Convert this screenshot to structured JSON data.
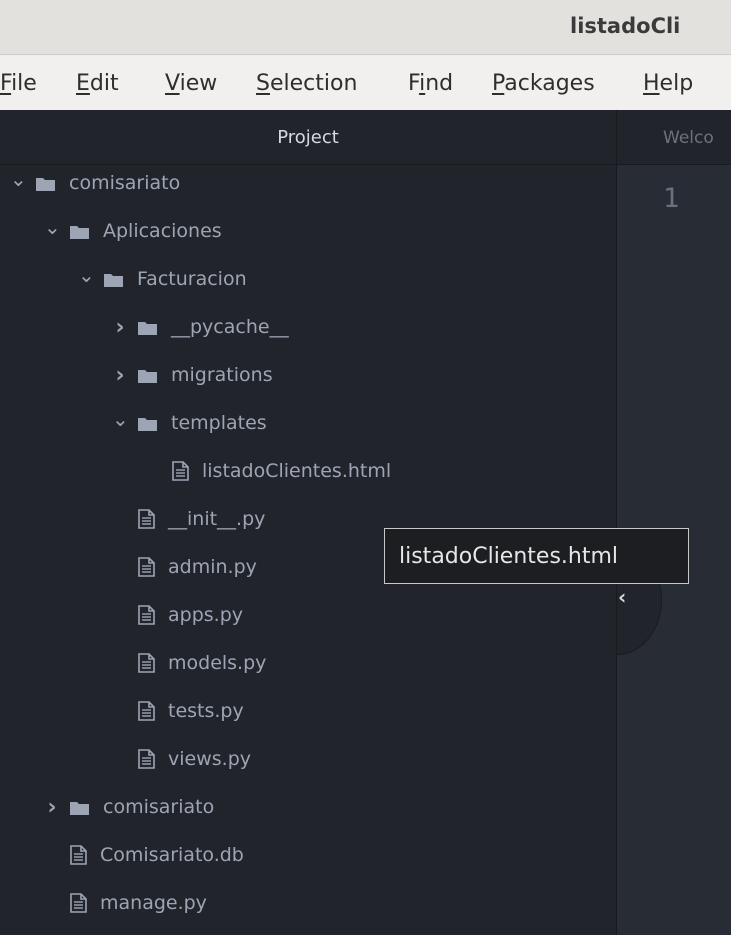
{
  "window": {
    "title": "listadoCli"
  },
  "menu": [
    {
      "accel": "F",
      "rest": "ile"
    },
    {
      "accel": "E",
      "rest": "dit"
    },
    {
      "accel": "V",
      "rest": "iew"
    },
    {
      "accel": "S",
      "rest": "election"
    },
    {
      "pre": "F",
      "accel": "i",
      "rest": "nd"
    },
    {
      "accel": "P",
      "rest": "ackages"
    },
    {
      "accel": "H",
      "rest": "elp"
    }
  ],
  "tree": {
    "header": "Project",
    "items": [
      {
        "label": "comisariato",
        "kind": "folder",
        "chevron": "down"
      },
      {
        "label": "Aplicaciones",
        "kind": "folder",
        "chevron": "down"
      },
      {
        "label": "Facturacion",
        "kind": "folder",
        "chevron": "down"
      },
      {
        "label": "__pycache__",
        "kind": "folder",
        "chevron": "right"
      },
      {
        "label": "migrations",
        "kind": "folder",
        "chevron": "right"
      },
      {
        "label": "templates",
        "kind": "folder",
        "chevron": "down"
      },
      {
        "label": "listadoClientes.html",
        "kind": "file"
      },
      {
        "label": "__init__.py",
        "kind": "file"
      },
      {
        "label": "admin.py",
        "kind": "file"
      },
      {
        "label": "apps.py",
        "kind": "file"
      },
      {
        "label": "models.py",
        "kind": "file"
      },
      {
        "label": "tests.py",
        "kind": "file"
      },
      {
        "label": "views.py",
        "kind": "file"
      },
      {
        "label": "comisariato",
        "kind": "folder",
        "chevron": "right"
      },
      {
        "label": "Comisariato.db",
        "kind": "file"
      },
      {
        "label": "manage.py",
        "kind": "file"
      }
    ]
  },
  "editor": {
    "tab_label": "Welco",
    "line_number": "1"
  },
  "tooltip": {
    "text": "listadoClientes.html"
  },
  "colors": {
    "tree_bg": "#21252b",
    "editor_bg": "#282c34",
    "text": "#9da5b4",
    "icon": "#9da5b4"
  }
}
